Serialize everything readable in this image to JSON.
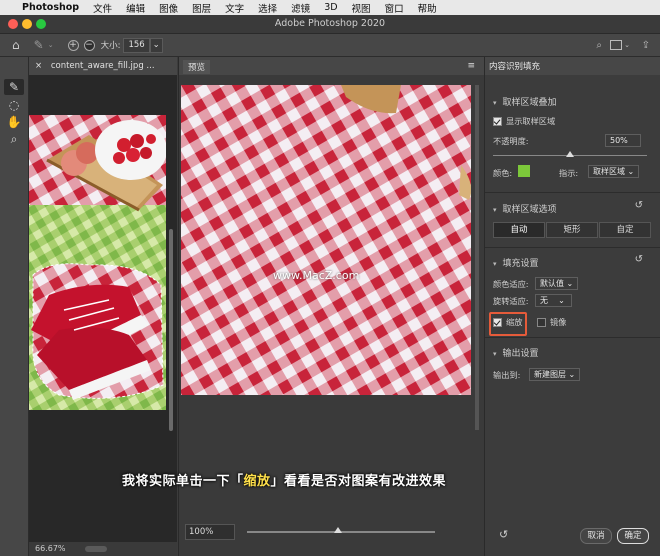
{
  "menubar": {
    "app": "Photoshop",
    "items": [
      "文件",
      "编辑",
      "图像",
      "图层",
      "文字",
      "选择",
      "滤镜",
      "3D",
      "视图",
      "窗口",
      "帮助"
    ]
  },
  "window": {
    "title": "Adobe Photoshop 2020"
  },
  "options_bar": {
    "size_label": "大小:",
    "size_value": "156"
  },
  "document": {
    "tab_name": "content_aware_fill.jpg ...",
    "zoom_status": "66.67%"
  },
  "preview": {
    "tab_label": "预览",
    "zoom_value": "100%",
    "zoom_fraction": 0.5,
    "watermark": "www.MacZ.com"
  },
  "panel": {
    "title": "内容识别填充",
    "sampling_overlay": {
      "heading": "取样区域叠加",
      "show_sampling_label": "显示取样区域",
      "show_sampling_checked": true,
      "opacity_label": "不透明度:",
      "opacity_value": "50%",
      "opacity_fraction": 0.5,
      "color_label": "颜色:",
      "color_value": "#7cc83a",
      "indicates_label": "指示:",
      "indicates_value": "取样区域"
    },
    "sampling_options": {
      "heading": "取样区域选项",
      "buttons": [
        "自动",
        "矩形",
        "自定"
      ],
      "selected": "自动"
    },
    "fill_settings": {
      "heading": "填充设置",
      "color_adapt_label": "颜色适应:",
      "color_adapt_value": "默认值",
      "rotation_adapt_label": "旋转适应:",
      "rotation_adapt_value": "无",
      "scale_label": "缩放",
      "scale_checked": true,
      "mirror_label": "镜像",
      "mirror_checked": false
    },
    "output_settings": {
      "heading": "输出设置",
      "output_to_label": "输出到:",
      "output_to_value": "新建图层"
    },
    "buttons": {
      "cancel": "取消",
      "ok": "确定"
    }
  },
  "caption": {
    "before": "我将实际单击一下「",
    "highlight": "缩放",
    "after": "」看看是否对图案有改进效果"
  },
  "colors": {
    "gingham_red": "#c8243a",
    "gingham_white": "#f4f1f4",
    "highlight_box": "#e55b3a",
    "caption_highlight": "#ffe04a"
  }
}
